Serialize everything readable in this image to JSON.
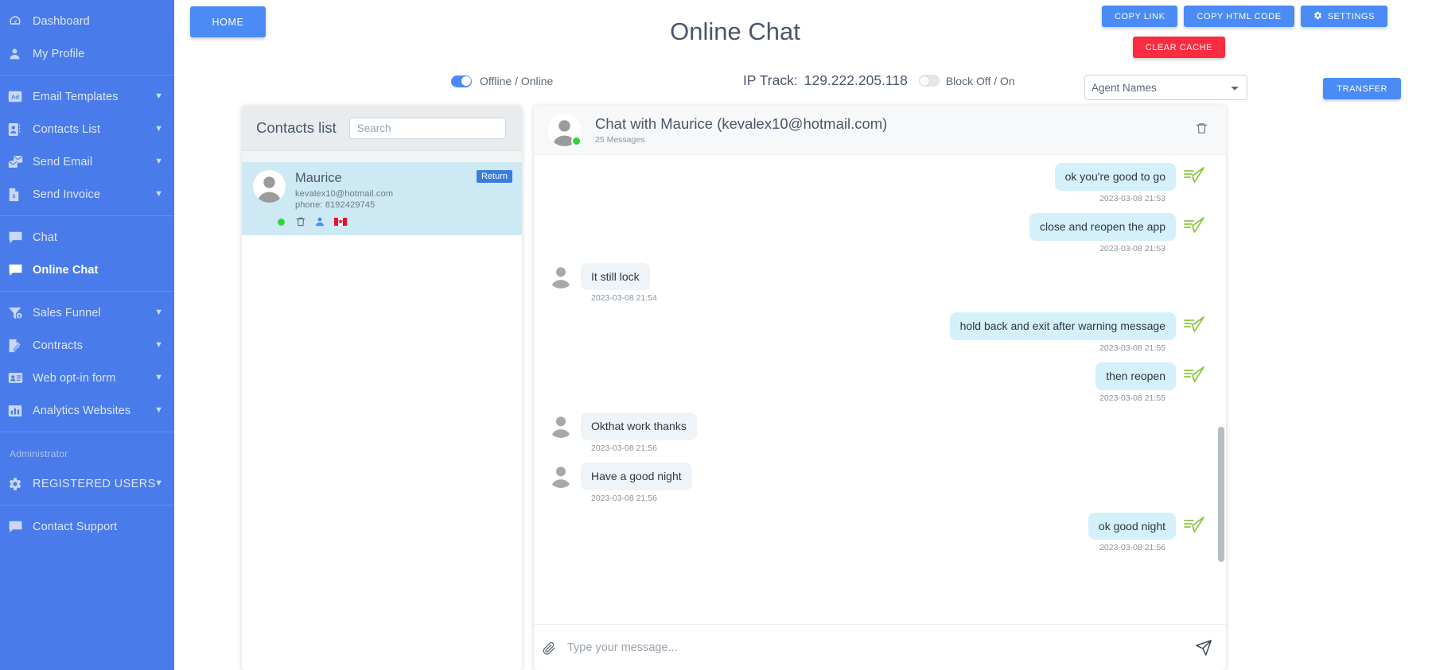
{
  "sidebar": {
    "groups": [
      {
        "items": [
          {
            "label": "Dashboard",
            "icon": "dashboard-icon",
            "chevron": false,
            "active": false
          },
          {
            "label": "My Profile",
            "icon": "user-icon",
            "chevron": false,
            "active": false
          }
        ]
      },
      {
        "items": [
          {
            "label": "Email Templates",
            "icon": "ad-icon",
            "chevron": true,
            "active": false
          },
          {
            "label": "Contacts List",
            "icon": "contact-card-icon",
            "chevron": true,
            "active": false
          },
          {
            "label": "Send Email",
            "icon": "send-email-icon",
            "chevron": true,
            "active": false
          },
          {
            "label": "Send Invoice",
            "icon": "invoice-icon",
            "chevron": true,
            "active": false
          }
        ]
      },
      {
        "items": [
          {
            "label": "Chat",
            "icon": "chat-bubble-icon",
            "chevron": false,
            "active": false
          },
          {
            "label": "Online Chat",
            "icon": "chat-bubble-filled-icon",
            "chevron": false,
            "active": true
          }
        ]
      },
      {
        "items": [
          {
            "label": "Sales Funnel",
            "icon": "funnel-icon",
            "chevron": true,
            "active": false
          },
          {
            "label": "Contracts",
            "icon": "contract-icon",
            "chevron": true,
            "active": false
          },
          {
            "label": "Web opt-in form",
            "icon": "web-form-icon",
            "chevron": true,
            "active": false
          },
          {
            "label": "Analytics Websites",
            "icon": "bar-chart-icon",
            "chevron": true,
            "active": false
          }
        ]
      },
      {
        "caption": "Administrator",
        "items": [
          {
            "label": "REGISTERED USERS",
            "icon": "gear-icon",
            "chevron": true,
            "active": false,
            "caps": true
          }
        ]
      },
      {
        "items": [
          {
            "label": "Contact Support",
            "icon": "support-chat-icon",
            "chevron": false,
            "active": false
          }
        ]
      }
    ]
  },
  "header": {
    "home_label": "HOME",
    "title": "Online Chat",
    "copy_link_label": "COPY LINK",
    "copy_html_label": "COPY HTML CODE",
    "settings_label": "SETTINGS",
    "clear_cache_label": "CLEAR CACHE",
    "offline_online_label": "Offline / Online",
    "offline_online_on": true,
    "ip_track_label": "IP Track:",
    "ip_track_value": "129.222.205.118",
    "block_label": "Block Off / On",
    "block_on": false,
    "agent_select_value": "Agent Names",
    "agent_options": [
      "Agent Names"
    ],
    "transfer_label": "TRANSFER"
  },
  "contacts": {
    "title": "Contacts list",
    "search_placeholder": "Search",
    "search_value": "",
    "items": [
      {
        "name": "Maurice",
        "email": "kevalex10@hotmail.com",
        "phone": "phone: 8192429745",
        "badge": "Return",
        "online": true,
        "country": "CA"
      }
    ]
  },
  "chat": {
    "title": "Chat with Maurice",
    "email": "(kevalex10@hotmail.com)",
    "message_count": "25 Messages",
    "input_placeholder": "Type your message...",
    "input_value": "",
    "messages": [
      {
        "side": "right",
        "text": "ok you're good to go",
        "time": "2023-03-08 21:53"
      },
      {
        "side": "right",
        "text": "close and reopen the app",
        "time": "2023-03-08 21:53"
      },
      {
        "side": "left",
        "text": "It still lock",
        "time": "2023-03-08 21:54"
      },
      {
        "side": "right",
        "text": "hold back and exit after warning message",
        "time": "2023-03-08 21:55"
      },
      {
        "side": "right",
        "text": "then reopen",
        "time": "2023-03-08 21:55"
      },
      {
        "side": "left",
        "text": "Okthat work thanks",
        "time": "2023-03-08 21:56"
      },
      {
        "side": "left",
        "text": "Have a good night",
        "time": "2023-03-08 21:56"
      },
      {
        "side": "right",
        "text": "ok good night",
        "time": "2023-03-08 21:56"
      }
    ]
  },
  "colors": {
    "sidebar_bg": "#4a7bea",
    "primary": "#4a8bf5",
    "danger": "#fb2c3f",
    "bubble_out": "#d4f0fa",
    "bubble_in": "#eef4f7",
    "contact_selected": "#cdeaf4",
    "online_dot": "#31d43a"
  }
}
